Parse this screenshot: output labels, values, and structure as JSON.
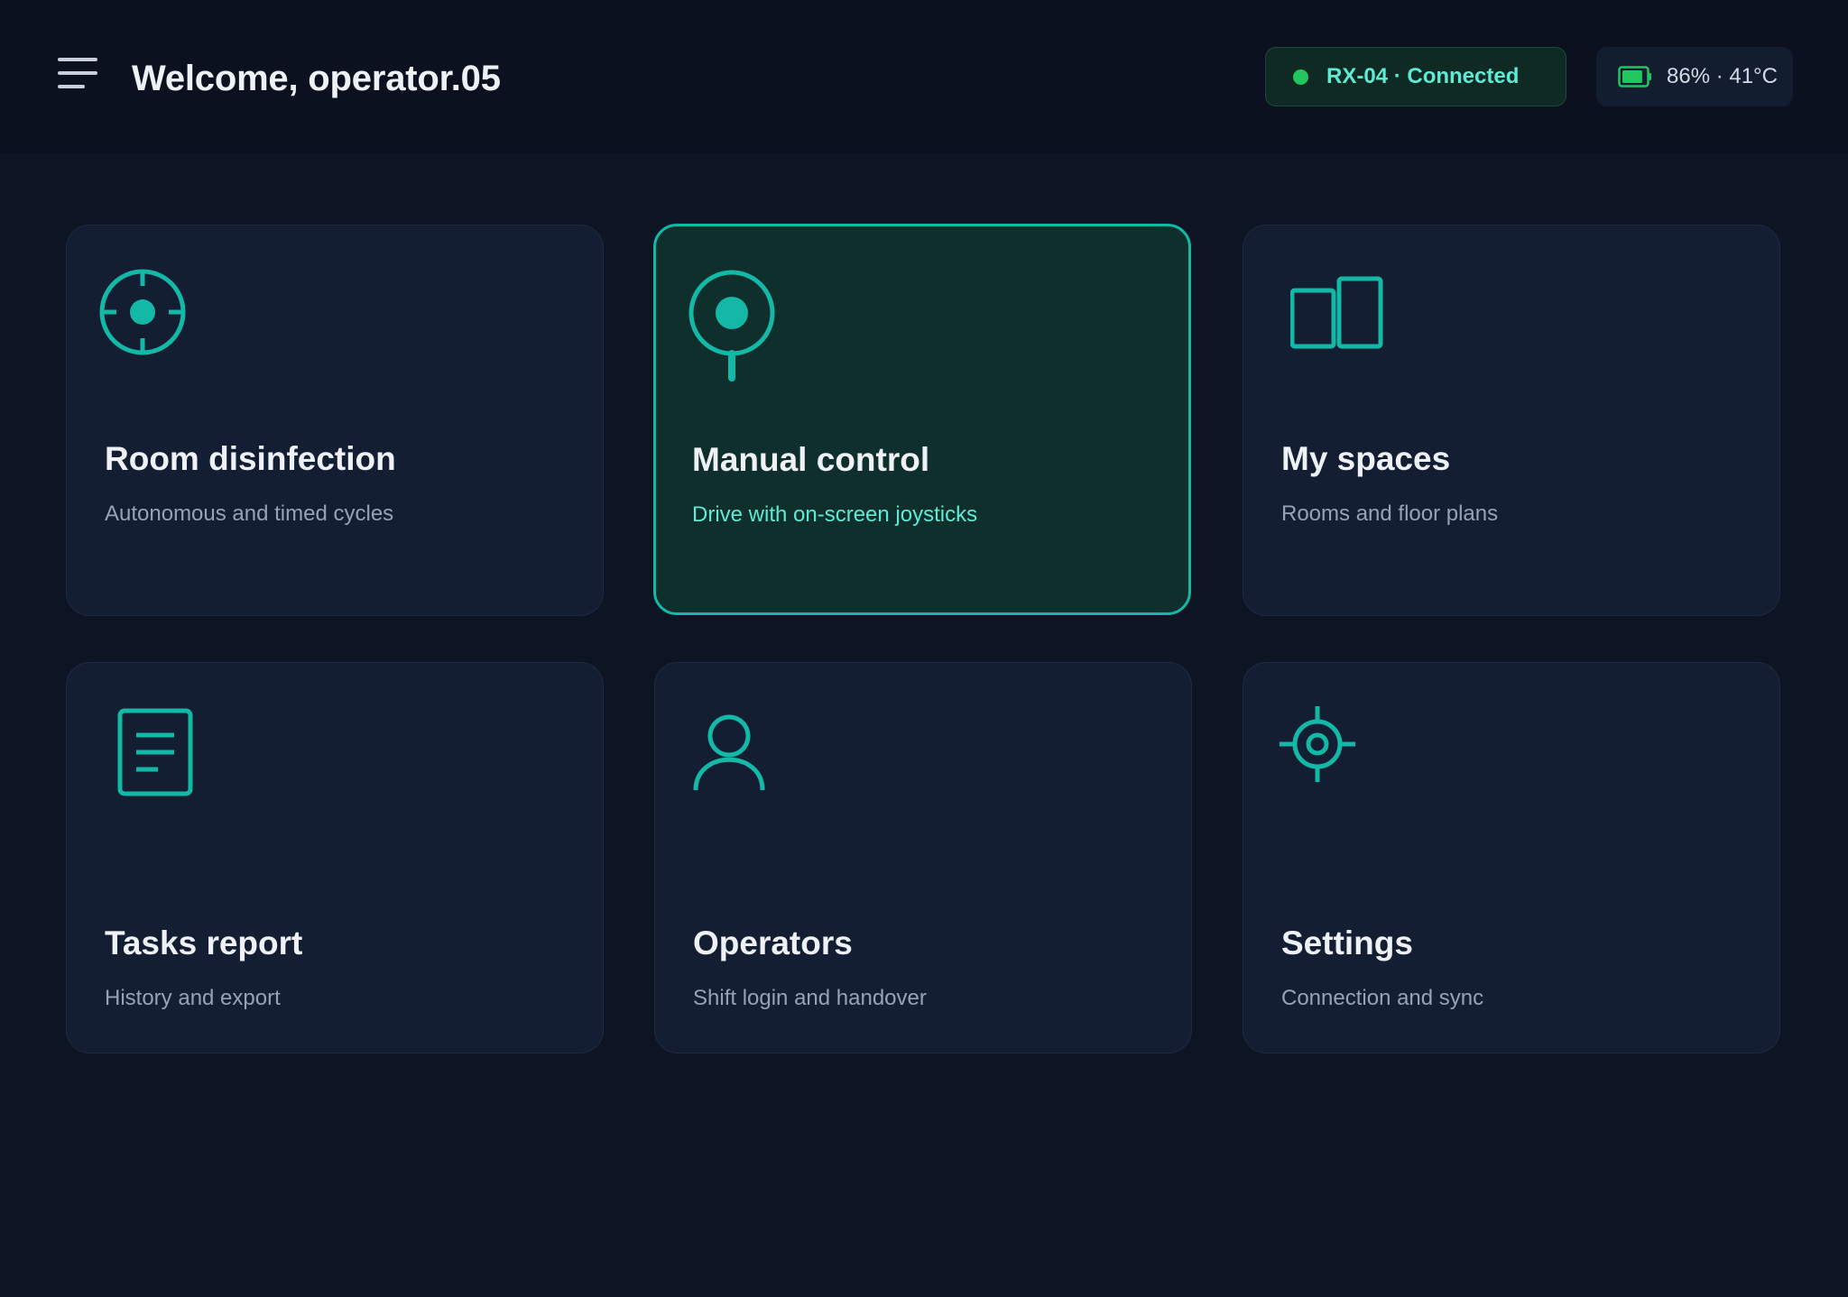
{
  "header": {
    "welcome_text": "Welcome, operator.05",
    "connection": {
      "label": "RX-04 · Connected",
      "status_color": "#22c55e"
    },
    "battery": {
      "label": "86% · 41°C",
      "level_percent": 86
    }
  },
  "colors": {
    "accent": "#14b8a6",
    "accent_light": "#5eead4",
    "background": "#0d1423",
    "tile": "#141e33",
    "active_tile": "#0f2f2d"
  },
  "tiles": [
    {
      "title": "Room disinfection",
      "subtitle": "Autonomous and timed cycles",
      "icon": "crosshair-icon",
      "active": false
    },
    {
      "title": "Manual control",
      "subtitle": "Drive with on-screen joysticks",
      "icon": "joystick-icon",
      "active": true
    },
    {
      "title": "My spaces",
      "subtitle": "Rooms and floor plans",
      "icon": "rooms-icon",
      "active": false
    },
    {
      "title": "Tasks report",
      "subtitle": "History and export",
      "icon": "document-icon",
      "active": false
    },
    {
      "title": "Operators",
      "subtitle": "Shift login and handover",
      "icon": "user-icon",
      "active": false
    },
    {
      "title": "Settings",
      "subtitle": "Connection and sync",
      "icon": "settings-target-icon",
      "active": false
    }
  ]
}
